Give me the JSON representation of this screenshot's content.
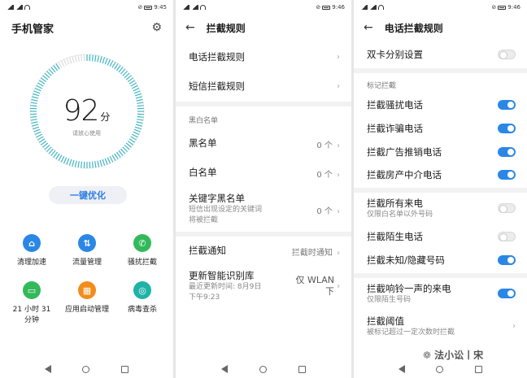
{
  "status": [
    {
      "left": "📶 ᯤ ⚡",
      "time": "9:45"
    },
    {
      "left": "📶 ᯤ ⚡",
      "time": "9:46"
    },
    {
      "left": "📶 ᯤ ⚡",
      "time": "9:46"
    }
  ],
  "home": {
    "title": "手机管家",
    "score": "92",
    "score_unit": "分",
    "score_subtitle": "请放心使用",
    "optimize_label": "一键优化",
    "tools": [
      {
        "label": "清理加速",
        "icon": "broom-icon",
        "color": "#2a87e6",
        "glyph": "⌂"
      },
      {
        "label": "流量管理",
        "icon": "data-traffic-icon",
        "color": "#2a87e6",
        "glyph": "⇅"
      },
      {
        "label": "骚扰拦截",
        "icon": "phone-block-icon",
        "color": "#33b95a",
        "glyph": "✆"
      },
      {
        "label": "21 小时 31 分钟",
        "icon": "battery-icon",
        "color": "#33b95a",
        "glyph": "▭"
      },
      {
        "label": "应用启动管理",
        "icon": "app-launch-icon",
        "color": "#f28c1a",
        "glyph": "▦"
      },
      {
        "label": "病毒查杀",
        "icon": "virus-scan-icon",
        "color": "#1fb3a8",
        "glyph": "◎"
      }
    ]
  },
  "rules": {
    "title": "拦截规则",
    "phone_rules": "电话拦截规则",
    "sms_rules": "短信拦截规则",
    "section_lists": "黑白名单",
    "blacklist": "黑名单",
    "blacklist_count": "0 个",
    "whitelist": "白名单",
    "whitelist_count": "0 个",
    "keyword_blacklist": "关键字黑名单",
    "keyword_desc_1": "短信出现设定的关键词",
    "keyword_desc_2": "将被拦截",
    "keyword_count": "0 个",
    "notify": "拦截通知",
    "notify_value": "拦截时通知",
    "update_lib": "更新智能识别库",
    "update_desc_1": "最近更新时间: 8月9日",
    "update_desc_2": "下午9:23",
    "update_value_1": "仅 WLAN",
    "update_value_2": "下"
  },
  "phone": {
    "title": "电话拦截规则",
    "dual_sim": "双卡分别设置",
    "section_marked": "标记拦截",
    "harass": "拦截骚扰电话",
    "fraud": "拦截诈骗电话",
    "ads": "拦截广告推销电话",
    "agency": "拦截房产中介电话",
    "all_incoming": "拦截所有来电",
    "all_incoming_desc": "仅限白名单以外号码",
    "strangers": "拦截陌生电话",
    "unknown_hidden": "拦截未知/隐藏号码",
    "one_ring": "拦截响铃一声的来电",
    "one_ring_desc": "仅限陌生号码",
    "threshold": "拦截阈值",
    "threshold_desc": "被标记超过一定次数时拦截"
  },
  "watermark": "法小讼丨宋",
  "watermark_small": "法小讼丨宋"
}
